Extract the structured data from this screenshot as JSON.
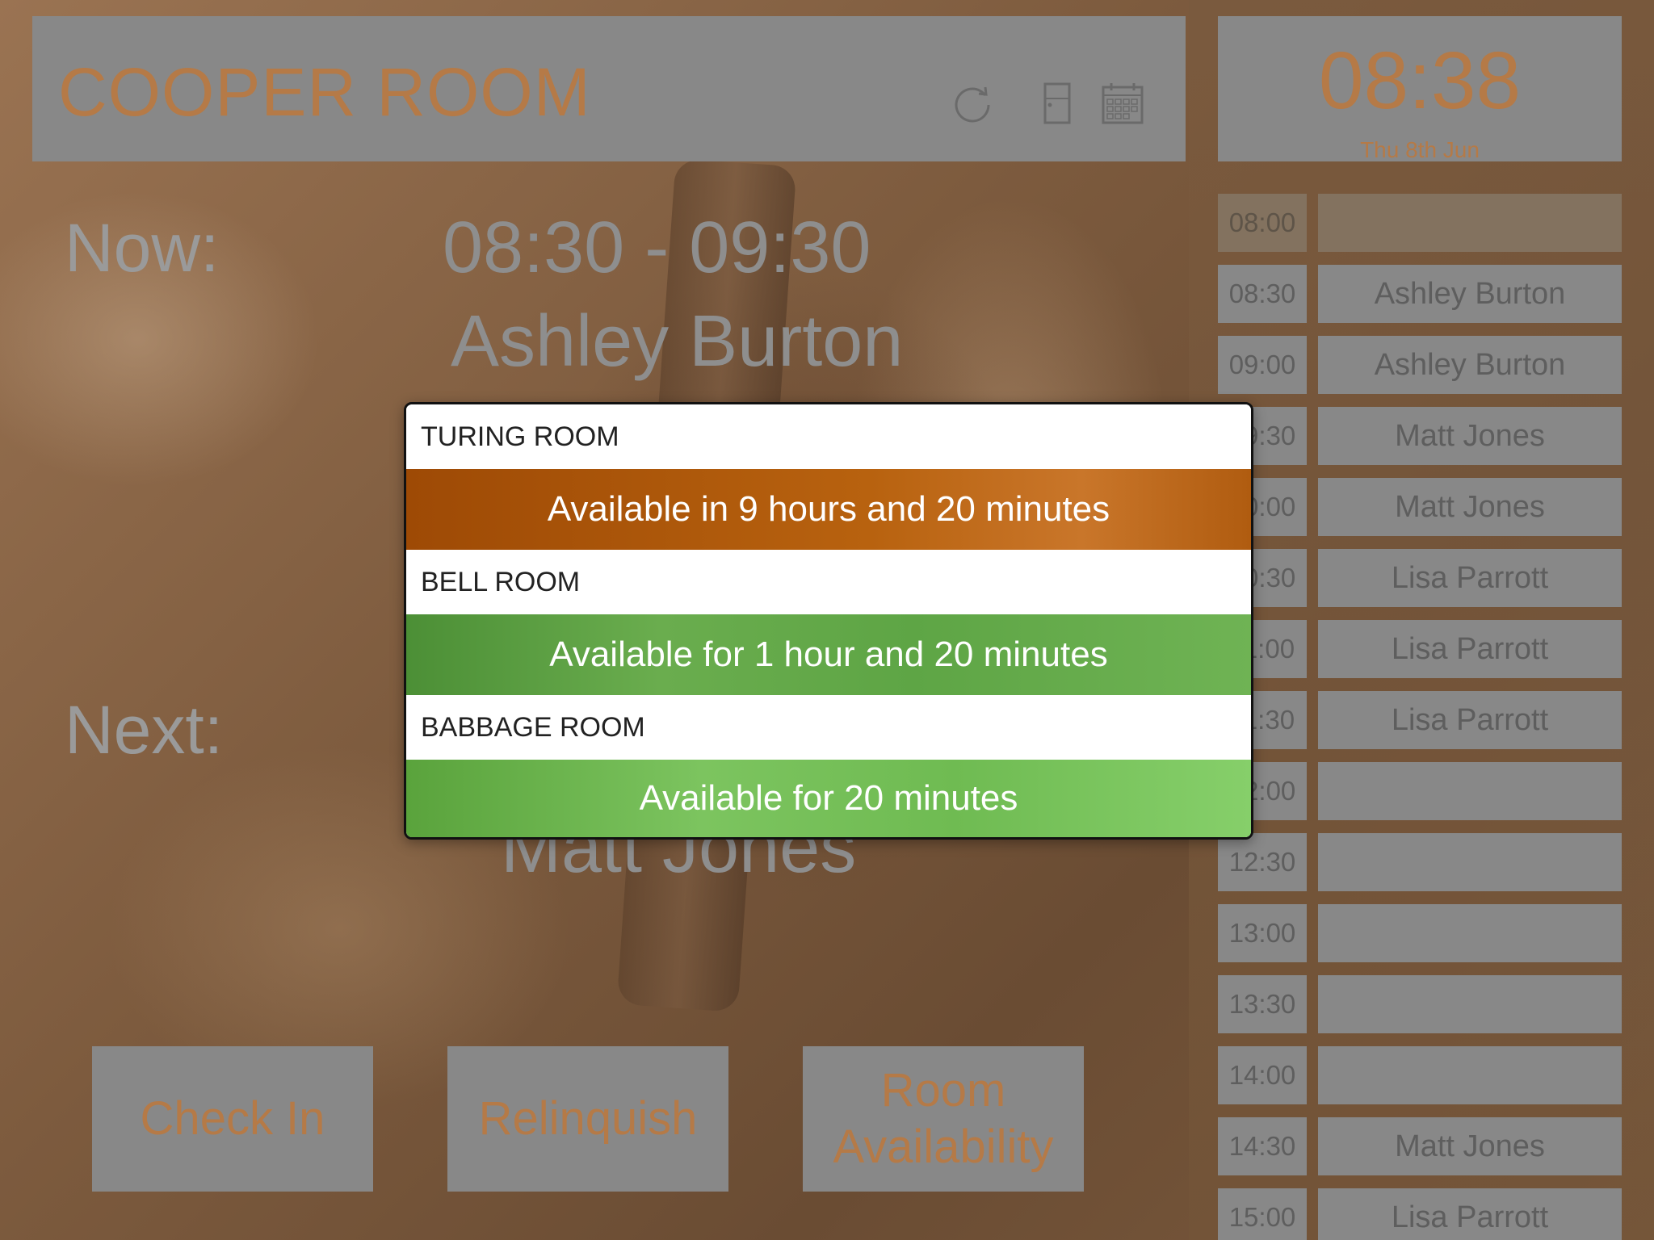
{
  "header": {
    "room_name": "COOPER ROOM",
    "icons": [
      "refresh-icon",
      "door-icon",
      "calendar-icon"
    ]
  },
  "clock": {
    "time": "08:38",
    "date": "Thu 8th Jun"
  },
  "now": {
    "label": "Now:",
    "time_range": "08:30 - 09:30",
    "organizer": "Ashley Burton"
  },
  "next": {
    "label": "Next:",
    "organizer": "Matt Jones"
  },
  "buttons": {
    "check_in": "Check In",
    "relinquish": "Relinquish",
    "room_availability": "Room Availability"
  },
  "schedule": [
    {
      "time": "08:00",
      "name": ""
    },
    {
      "time": "08:30",
      "name": "Ashley Burton"
    },
    {
      "time": "09:00",
      "name": "Ashley Burton"
    },
    {
      "time": "09:30",
      "name": "Matt Jones"
    },
    {
      "time": "10:00",
      "name": "Matt Jones"
    },
    {
      "time": "10:30",
      "name": "Lisa Parrott"
    },
    {
      "time": "11:00",
      "name": "Lisa Parrott"
    },
    {
      "time": "11:30",
      "name": "Lisa Parrott"
    },
    {
      "time": "12:00",
      "name": ""
    },
    {
      "time": "12:30",
      "name": ""
    },
    {
      "time": "13:00",
      "name": ""
    },
    {
      "time": "13:30",
      "name": ""
    },
    {
      "time": "14:00",
      "name": ""
    },
    {
      "time": "14:30",
      "name": "Matt Jones"
    },
    {
      "time": "15:00",
      "name": "Lisa Parrott"
    }
  ],
  "availability_popup": {
    "rooms": [
      {
        "name": "TURING ROOM",
        "status": "Available in 9 hours and 20 minutes",
        "color": "#b05a0a"
      },
      {
        "name": "BELL ROOM",
        "status": "Available for 1 hour and 20 minutes",
        "color": "#5ea545"
      },
      {
        "name": "BABBAGE ROOM",
        "status": "Available for 20 minutes",
        "color": "#6fbb52"
      }
    ]
  },
  "colors": {
    "accent": "#b57a47",
    "panel": "#888888",
    "muted_text": "#5e5e5e"
  }
}
